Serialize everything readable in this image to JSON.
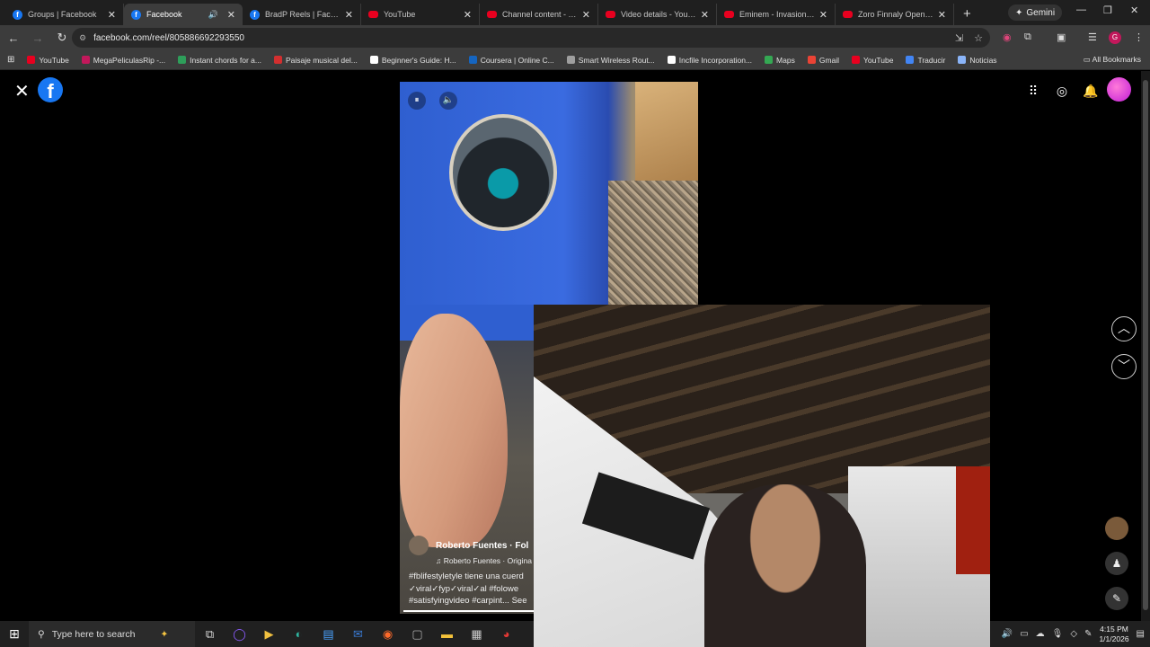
{
  "tabs": [
    {
      "title": "Groups | Facebook",
      "icon": "facebook-icon",
      "active": false
    },
    {
      "title": "Facebook",
      "icon": "facebook-icon",
      "active": true
    },
    {
      "title": "BradP Reels | Facebook",
      "icon": "facebook-icon",
      "active": false
    },
    {
      "title": "YouTube",
      "icon": "youtube-icon",
      "active": false
    },
    {
      "title": "Channel content - YouT",
      "icon": "youtube-icon",
      "active": false
    },
    {
      "title": "Video details - YouTub",
      "icon": "youtube-icon",
      "active": false
    },
    {
      "title": "Eminem - Invasion (The",
      "icon": "youtube-icon",
      "active": false
    },
    {
      "title": "Zoro Finnaly Opens His",
      "icon": "youtube-icon",
      "active": false
    }
  ],
  "gemini_label": "Gemini",
  "address": {
    "url": "facebook.com/reel/805886692293550"
  },
  "profile_initial": "G",
  "bookmarks": [
    {
      "label": "YouTube",
      "color": "#e8001f"
    },
    {
      "label": "MegaPeliculasRip -...",
      "color": "#c2185b"
    },
    {
      "label": "Instant chords for a...",
      "color": "#2e9e5a"
    },
    {
      "label": "Paisaje musical del...",
      "color": "#d32f2f"
    },
    {
      "label": "Beginner's Guide: H...",
      "color": "#ffffff"
    },
    {
      "label": "Coursera | Online C...",
      "color": "#1565c0"
    },
    {
      "label": "Smart Wireless Rout...",
      "color": "#9e9e9e"
    },
    {
      "label": "Incfile Incorporation...",
      "color": "#ffffff"
    },
    {
      "label": "Maps",
      "color": "#34a853"
    },
    {
      "label": "Gmail",
      "color": "#ea4335"
    },
    {
      "label": "YouTube",
      "color": "#e8001f"
    },
    {
      "label": "Traducir",
      "color": "#4285f4"
    },
    {
      "label": "Noticias",
      "color": "#8ab4f8"
    }
  ],
  "all_bookmarks_label": "All Bookmarks",
  "reel": {
    "author": "Roberto Fuentes · Fol",
    "audio": "♫ Roberto Fuentes · Origina",
    "caption_line1": "#fblifestyletyle tiene una cuerd",
    "caption_line2": "✓viral✓fyp✓viral✓al #folowe",
    "caption_line3": "#satisfyingvideo #carpint... See",
    "progress": 0.45
  },
  "taskbar": {
    "search_placeholder": "Type here to search",
    "time": "4:15 PM",
    "date": "1/1/2026"
  }
}
